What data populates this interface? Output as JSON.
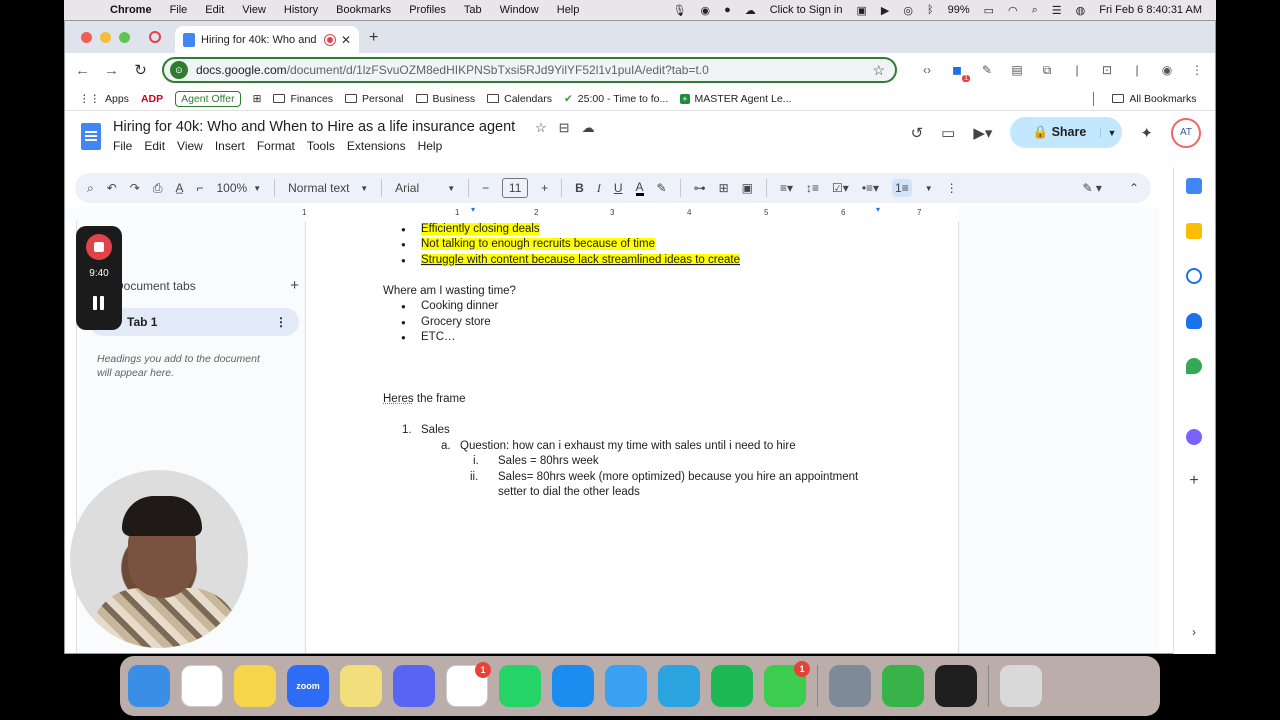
{
  "menubar": {
    "app": "Chrome",
    "items": [
      "File",
      "Edit",
      "View",
      "History",
      "Bookmarks",
      "Profiles",
      "Tab",
      "Window",
      "Help"
    ],
    "click_to_sign_in": "Click to Sign in",
    "battery": "99%",
    "clock": "Fri Feb 6  8:40:31 AM"
  },
  "browser": {
    "tab_title": "Hiring for 40k: Who and W",
    "url_host": "docs.google.com",
    "url_path": "/document/d/1lzFSvuOZM8edHIKPNSbTxsi5RJd9YilYF52l1v1puIA/edit?tab=t.0",
    "extension_badge": "1"
  },
  "bookmarks": {
    "items": [
      {
        "label": "Apps",
        "kind": "apps"
      },
      {
        "label": "ADP",
        "kind": "adp"
      },
      {
        "label": "Agent Offer",
        "kind": "agent"
      },
      {
        "label": "",
        "kind": "grid"
      },
      {
        "label": "Finances",
        "kind": "folder"
      },
      {
        "label": "Personal",
        "kind": "folder"
      },
      {
        "label": "Business",
        "kind": "folder"
      },
      {
        "label": "Calendars",
        "kind": "folder"
      },
      {
        "label": "25:00 - Time to fo...",
        "kind": "check"
      },
      {
        "label": "MASTER Agent Le...",
        "kind": "sheet"
      }
    ],
    "all_bookmarks": "All Bookmarks"
  },
  "docs": {
    "title": "Hiring for 40k: Who and When to Hire as a life insurance agent",
    "menu": [
      "File",
      "Edit",
      "View",
      "Insert",
      "Format",
      "Tools",
      "Extensions",
      "Help"
    ],
    "share_label": "Share",
    "avatar_initials": "AT",
    "toolbar": {
      "zoom": "100%",
      "style": "Normal text",
      "font": "Arial",
      "font_size": "11"
    },
    "ruler_numbers": [
      "1",
      "1",
      "2",
      "3",
      "4",
      "5",
      "6",
      "7"
    ],
    "outline": {
      "heading": "Document tabs",
      "tab_name": "Tab 1",
      "hint": "Headings you add to the document will appear here."
    },
    "content": {
      "highlighted_bullets": [
        "Efficiently closing deals",
        "Not talking to enough recruits because of time",
        "Struggle with content because lack streamlined ideas to create"
      ],
      "question": "Where am I wasting time?",
      "time_bullets": [
        "Cooking dinner",
        "Grocery store",
        "ETC…"
      ],
      "frame_prefix": "Heres",
      "frame_rest": " the frame",
      "list_num": "1.",
      "list_item": "Sales",
      "sub_letter": "a.",
      "sub_item": "Question: how can i exhaust my time with sales until i need to hire",
      "roman": [
        {
          "n": "i.",
          "text": "Sales = 80hrs week"
        },
        {
          "n": "ii.",
          "text": "Sales= 80hrs week (more optimized) because you hire an appointment"
        }
      ],
      "roman_cont": "setter to dial the other leads"
    }
  },
  "recorder": {
    "time": "9:40"
  },
  "dock": {
    "apps": [
      {
        "name": "finder",
        "color": "#3a8ee6",
        "label": ""
      },
      {
        "name": "chrome",
        "color": "#ffffff",
        "label": ""
      },
      {
        "name": "notes",
        "color": "#f7d54a",
        "label": ""
      },
      {
        "name": "zoom",
        "color": "#2d6cf5",
        "label": "zoom"
      },
      {
        "name": "stickies",
        "color": "#f2de7a",
        "label": ""
      },
      {
        "name": "discord",
        "color": "#5865f2",
        "label": ""
      },
      {
        "name": "reminders",
        "color": "#ffffff",
        "label": "",
        "badge": "1"
      },
      {
        "name": "whatsapp",
        "color": "#25d366",
        "label": ""
      },
      {
        "name": "app-store",
        "color": "#1d8cf0",
        "label": ""
      },
      {
        "name": "safari",
        "color": "#3aa0f0",
        "label": ""
      },
      {
        "name": "telegram",
        "color": "#2aa3df",
        "label": ""
      },
      {
        "name": "spotify",
        "color": "#1db954",
        "label": ""
      },
      {
        "name": "messages",
        "color": "#3ccd4f",
        "label": "",
        "badge": "1"
      }
    ],
    "apps_right": [
      {
        "name": "preview",
        "color": "#7f8a99",
        "label": ""
      },
      {
        "name": "numbers",
        "color": "#37b34a",
        "label": ""
      },
      {
        "name": "terminal-app",
        "color": "#1e1e1e",
        "label": ""
      }
    ]
  },
  "colors": {
    "highlight": "#ffff00",
    "share_bg": "#c2e7ff",
    "recorder_red": "#e0434a"
  }
}
